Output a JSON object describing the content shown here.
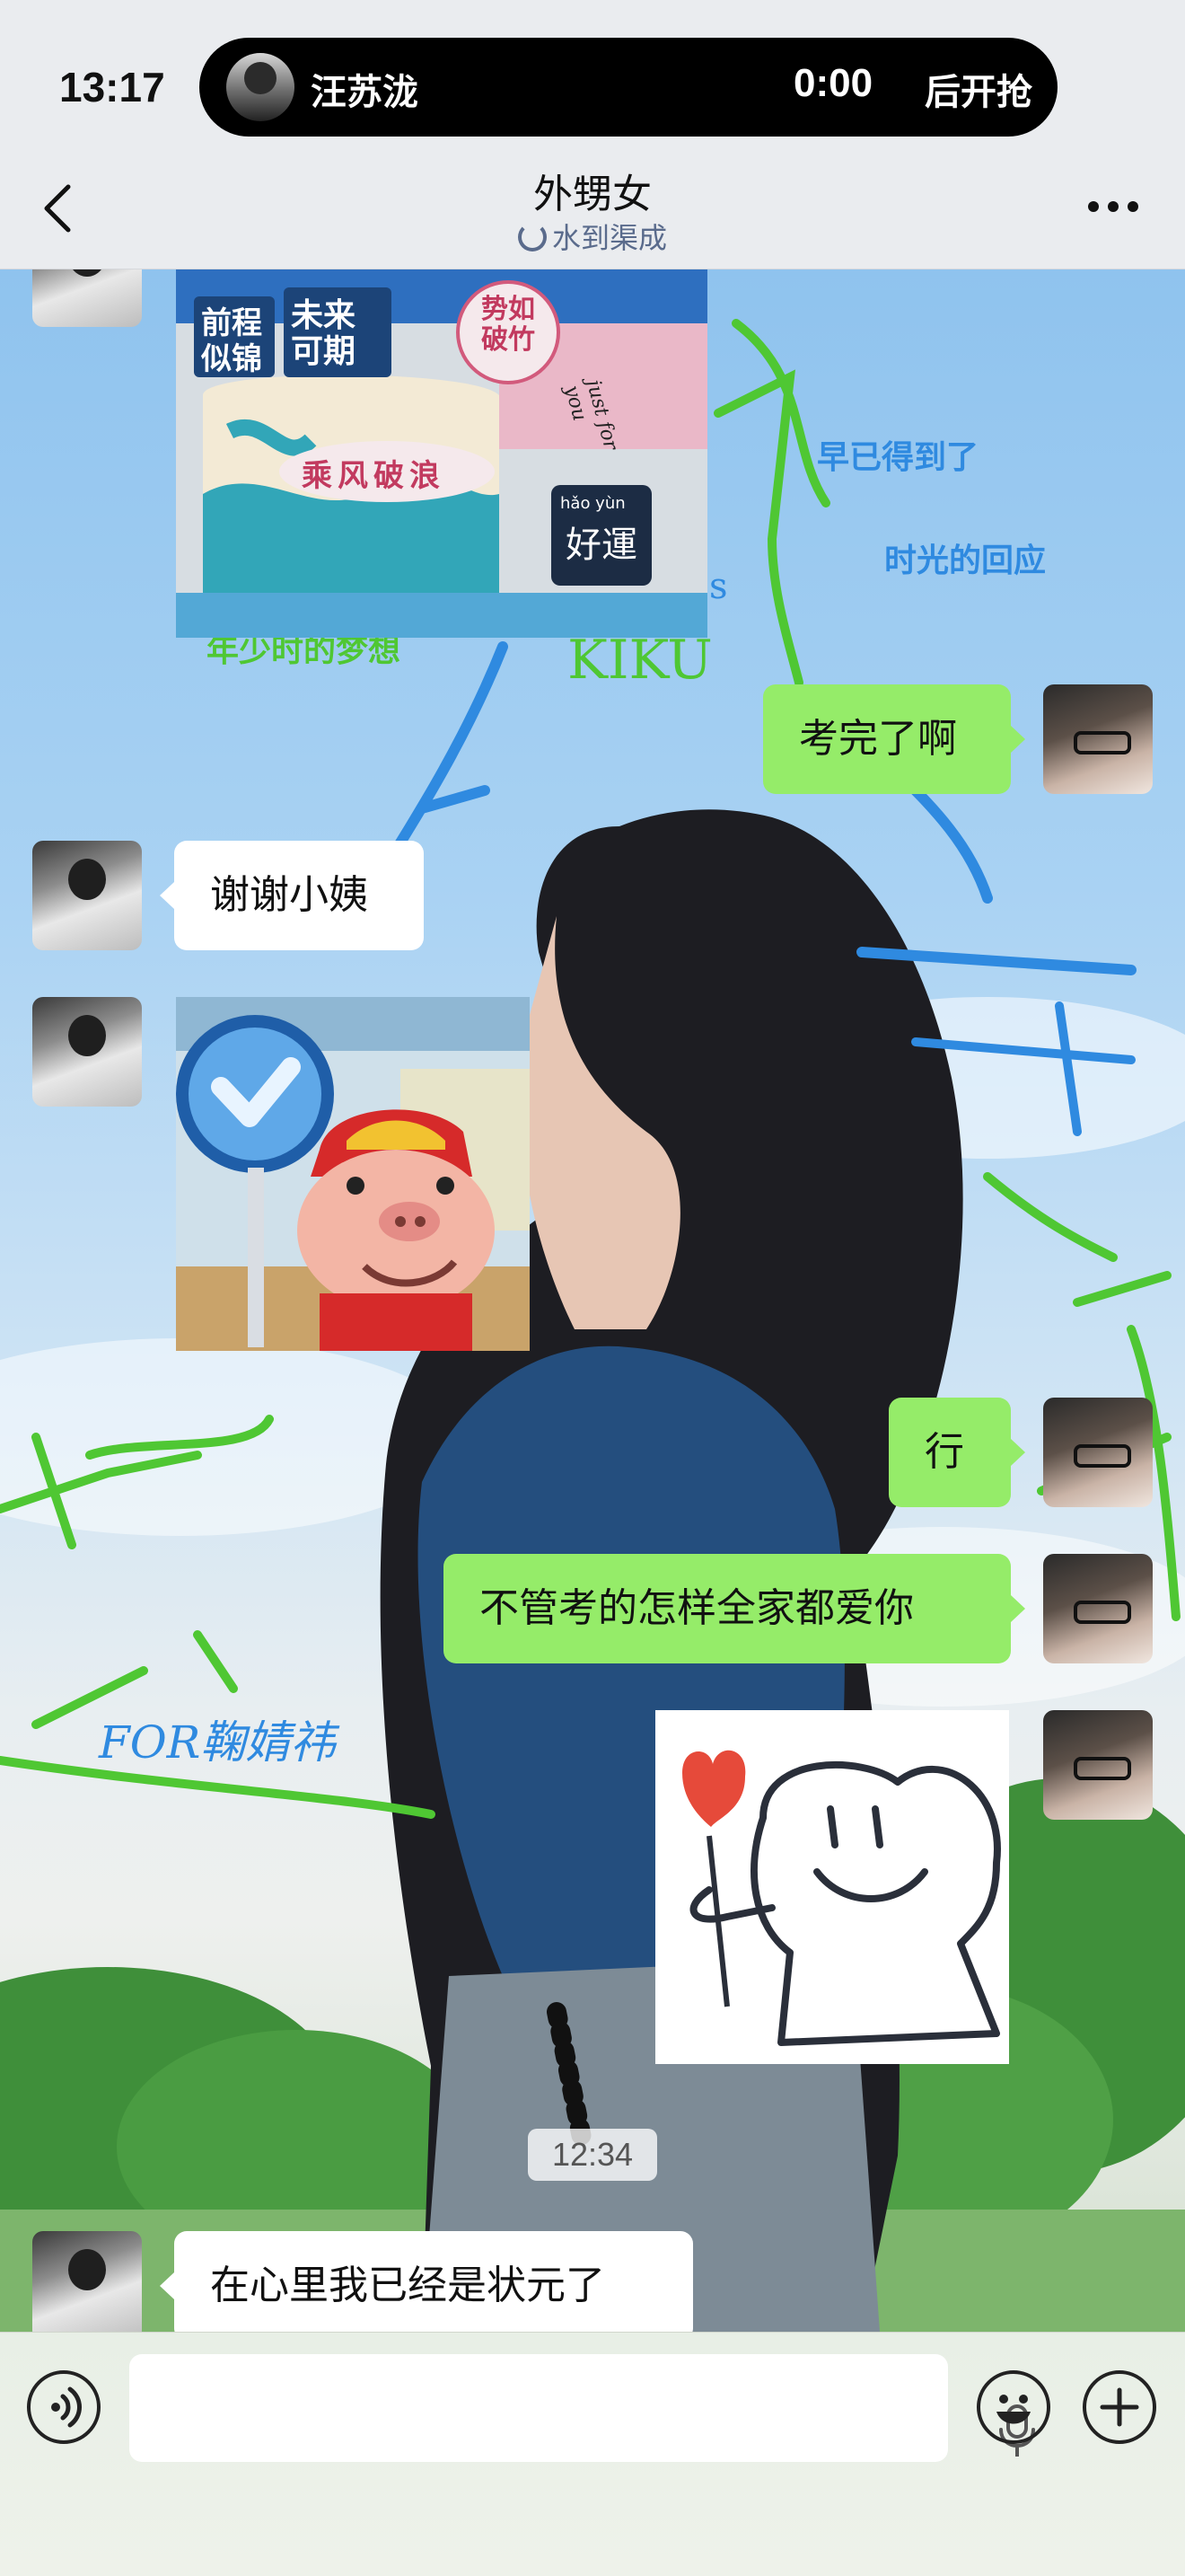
{
  "status_bar": {
    "time": "13:17",
    "live": {
      "name": "汪苏泷",
      "countdown": "0:00",
      "action": "后开抢"
    }
  },
  "nav": {
    "title": "外甥女",
    "subtitle": "水到渠成",
    "back_icon": "chevron-left-icon",
    "more_icon": "more-dots-icon"
  },
  "background_text": {
    "line1": "早已得到了",
    "line2": "时光的回应",
    "line3": "年少时的梦想",
    "line4": "KIKU",
    "line5": "FOR鞠婧祎",
    "line6": "s"
  },
  "cake_text": {
    "sign1": "未来可期",
    "sign2": "势如破竹",
    "sign3": "乘风破浪",
    "sign4_pinyin": "hǎo yùn",
    "sign4": "好運",
    "sign5": "前程似锦",
    "ribbon": "just for you"
  },
  "messages": [
    {
      "side": "right",
      "type": "text",
      "text": "考完了啊"
    },
    {
      "side": "left",
      "type": "text",
      "text": "谢谢小姨"
    },
    {
      "side": "left",
      "type": "sticker",
      "sticker": "pig-sticker"
    },
    {
      "side": "right",
      "type": "text",
      "text": "行"
    },
    {
      "side": "right",
      "type": "text",
      "text": "不管考的怎样全家都爱你"
    },
    {
      "side": "right",
      "type": "sticker",
      "sticker": "flower-smile-sticker"
    },
    {
      "side": "left",
      "type": "text",
      "text": "在心里我已经是状元了"
    }
  ],
  "timestamp": "12:34",
  "input_bar": {
    "voice_icon": "voice-icon",
    "mic_icon": "mic-icon",
    "emoji_icon": "emoji-icon",
    "plus_icon": "plus-icon"
  },
  "colors": {
    "bubble_right": "#95ec69",
    "bubble_left": "#ffffff",
    "accent_green": "#4fc733",
    "subtitle": "#5a6b8c"
  }
}
